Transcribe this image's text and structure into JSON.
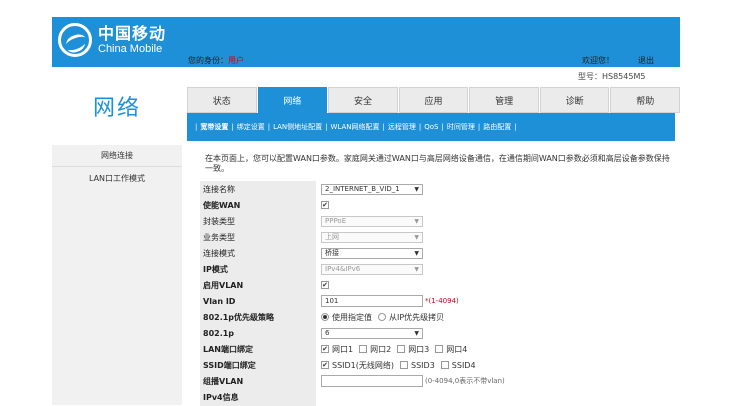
{
  "brand": {
    "cn": "中国移动",
    "en": "China Mobile"
  },
  "header": {
    "welcome_prefix": "您的身份：",
    "user": "用户",
    "welcome_right": "欢迎您！",
    "logout": "退出",
    "model": "型号：HS8545M5"
  },
  "page_title": "网络",
  "tabs": [
    {
      "label": "状态",
      "active": false
    },
    {
      "label": "网络",
      "active": true
    },
    {
      "label": "安全",
      "active": false
    },
    {
      "label": "应用",
      "active": false
    },
    {
      "label": "管理",
      "active": false
    },
    {
      "label": "诊断",
      "active": false
    },
    {
      "label": "帮助",
      "active": false
    }
  ],
  "subnav": {
    "items": [
      "宽带设置",
      "绑定设置",
      "LAN侧地址配置",
      "WLAN网络配置",
      "远程管理",
      "QoS",
      "时间管理",
      "路由配置"
    ],
    "sep": "|"
  },
  "left_menu": [
    "网络连接",
    "LAN口工作模式"
  ],
  "description": "在本页面上，您可以配置WAN口参数。家庭网关通过WAN口与高层网络设备通信，在通信期间WAN口参数必须和高层设备参数保持一致。",
  "form": {
    "connection_name": {
      "label": "连接名称",
      "value": "2_INTERNET_B_VID_1"
    },
    "enable_wan": {
      "label": "使能WAN",
      "checked": true
    },
    "encap_type": {
      "label": "封装类型",
      "value": "PPPoE"
    },
    "service_type": {
      "label": "业务类型",
      "value": "上网"
    },
    "conn_mode": {
      "label": "连接模式",
      "value": "桥接"
    },
    "ip_mode": {
      "label": "IP模式",
      "value": "IPv4&IPv6"
    },
    "enable_vlan": {
      "label": "启用VLAN",
      "checked": true
    },
    "vlan_id": {
      "label": "Vlan ID",
      "value": "101",
      "hint": "*(1-4094)"
    },
    "priority_policy": {
      "label": "802.1p优先级策略",
      "option1": "使用指定值",
      "option2": "从IP优先级拷贝"
    },
    "priority": {
      "label": "802.1p",
      "value": "6"
    },
    "lan_bind": {
      "label": "LAN端口绑定",
      "ports": [
        {
          "name": "网口1",
          "checked": true
        },
        {
          "name": "网口2",
          "checked": false
        },
        {
          "name": "网口3",
          "checked": false
        },
        {
          "name": "网口4",
          "checked": false
        }
      ]
    },
    "ssid_bind": {
      "label": "SSID端口绑定",
      "ports": [
        {
          "name": "SSID1(无线网络)",
          "checked": true
        },
        {
          "name": "SSID3",
          "checked": false
        },
        {
          "name": "SSID4",
          "checked": false
        }
      ]
    },
    "multicast_vlan": {
      "label": "组播VLAN",
      "value": "",
      "hint": "(0-4094,0表示不带vlan)"
    },
    "ipv4_info": {
      "label": "IPv4信息"
    }
  },
  "icons": {
    "select_arrow": "▼",
    "check": "✔"
  },
  "colors": {
    "accent": "#1e90d7",
    "required": "#d0021b"
  }
}
